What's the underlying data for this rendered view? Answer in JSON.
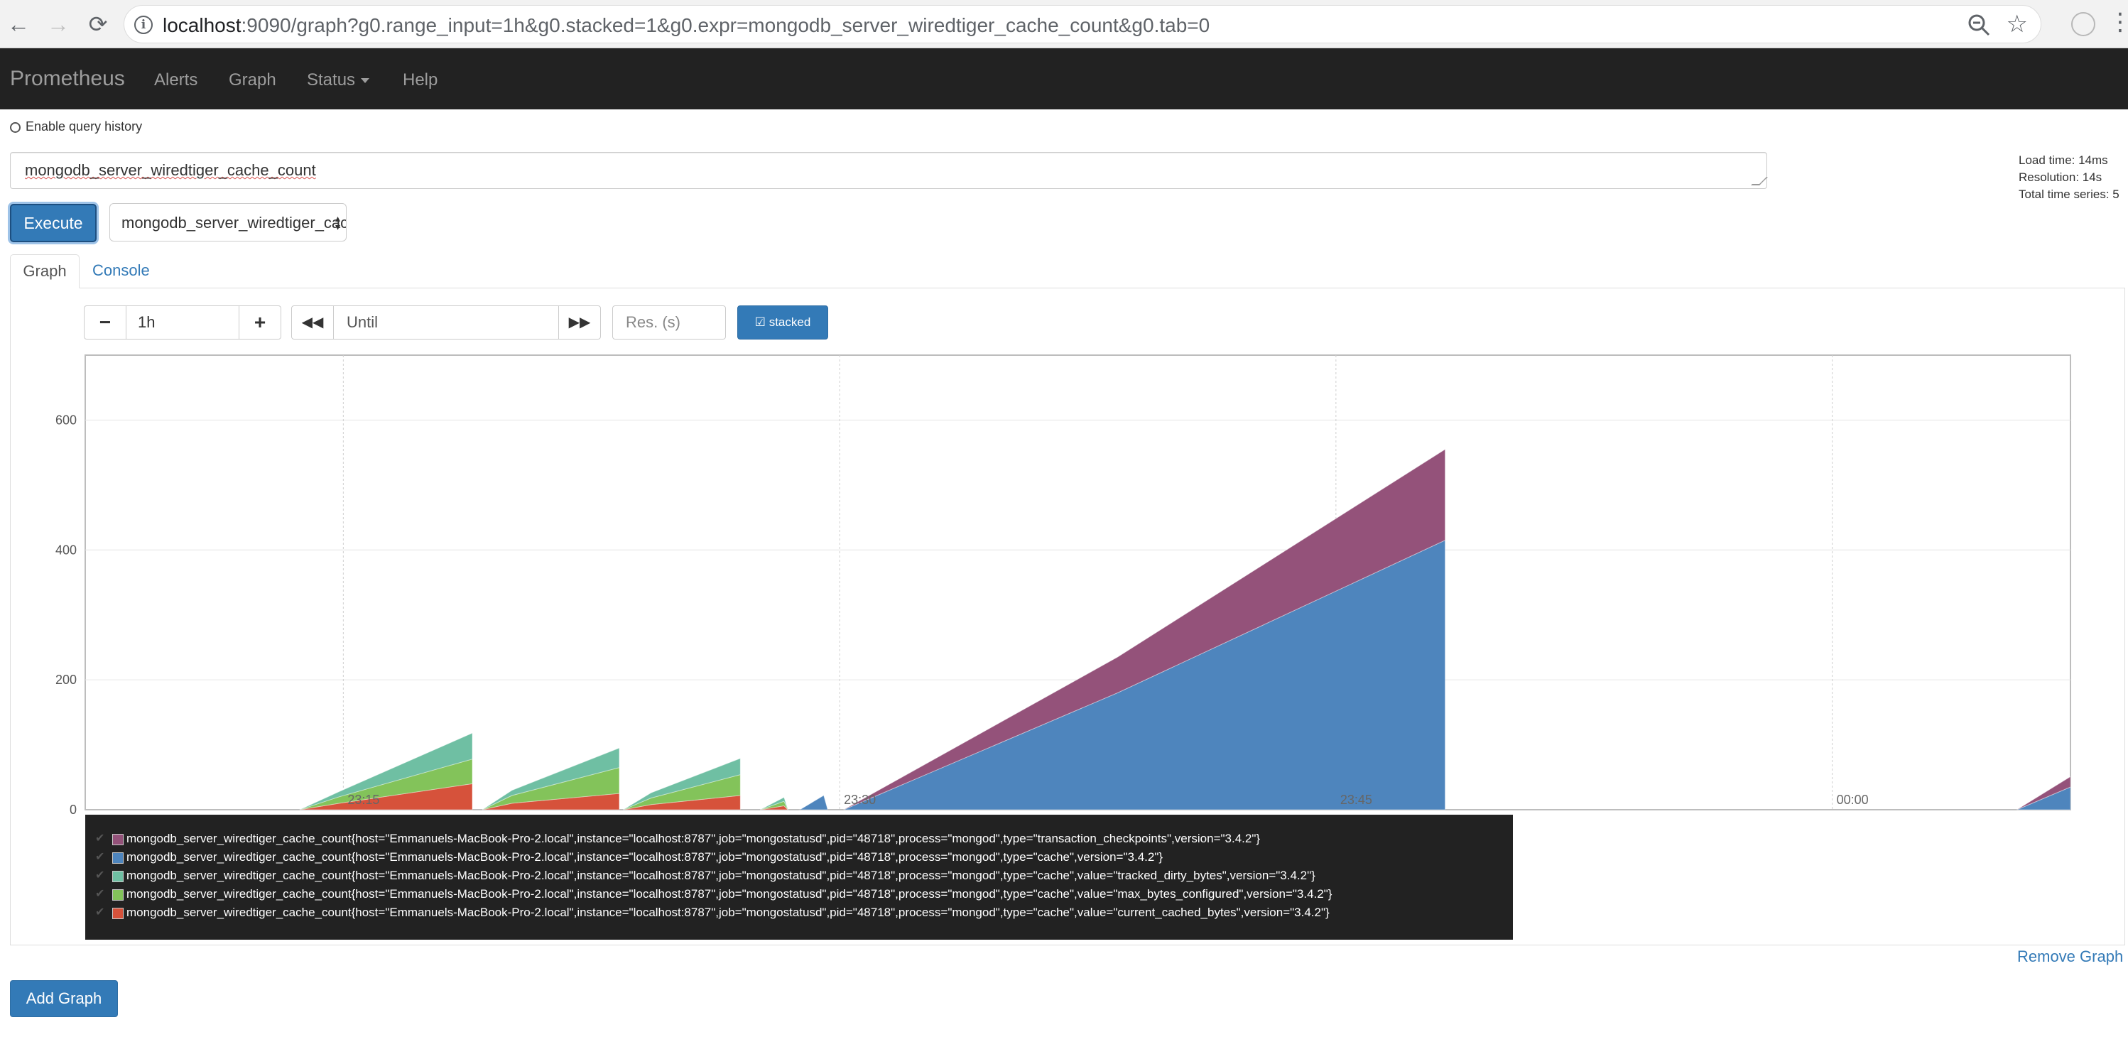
{
  "browser": {
    "url_host": "localhost",
    "url_rest": ":9090/graph?g0.range_input=1h&g0.stacked=1&g0.expr=mongodb_server_wiredtiger_cache_count&g0.tab=0"
  },
  "navbar": {
    "brand": "Prometheus",
    "items": [
      "Alerts",
      "Graph",
      "Status",
      "Help"
    ]
  },
  "query": {
    "history_label": "Enable query history",
    "expression": "mongodb_server_wiredtiger_cache_count",
    "execute_label": "Execute",
    "metric_select_value": "mongodb_server_wiredtiger_cache_count"
  },
  "stats": {
    "load_time": "Load time: 14ms",
    "resolution": "Resolution: 14s",
    "total_series": "Total time series: 5"
  },
  "tabs": [
    "Graph",
    "Console"
  ],
  "controls": {
    "minus": "−",
    "range_value": "1h",
    "plus": "+",
    "until_placeholder": "Until",
    "res_placeholder": "Res. (s)",
    "stacked_label": "stacked"
  },
  "chart_data": {
    "type": "area",
    "stacked": true,
    "y_ticks": [
      0,
      200,
      400,
      600
    ],
    "ylim": [
      0,
      700
    ],
    "x_tick_labels": [
      "23:15",
      "23:30",
      "23:45",
      "00:00"
    ],
    "series": [
      {
        "name": "mongodb_server_wiredtiger_cache_count{host=\"Emmanuels-MacBook-Pro-2.local\",instance=\"localhost:8787\",job=\"mongostatusd\",pid=\"48718\",process=\"mongod\",type=\"transaction_checkpoints\",version=\"3.4.2\"}",
        "color": "#94527a"
      },
      {
        "name": "mongodb_server_wiredtiger_cache_count{host=\"Emmanuels-MacBook-Pro-2.local\",instance=\"localhost:8787\",job=\"mongostatusd\",pid=\"48718\",process=\"mongod\",type=\"cache\",version=\"3.4.2\"}",
        "color": "#4e85bd"
      },
      {
        "name": "mongodb_server_wiredtiger_cache_count{host=\"Emmanuels-MacBook-Pro-2.local\",instance=\"localhost:8787\",job=\"mongostatusd\",pid=\"48718\",process=\"mongod\",type=\"cache\",value=\"tracked_dirty_bytes\",version=\"3.4.2\"}",
        "color": "#6fbfa3"
      },
      {
        "name": "mongodb_server_wiredtiger_cache_count{host=\"Emmanuels-MacBook-Pro-2.local\",instance=\"localhost:8787\",job=\"mongostatusd\",pid=\"48718\",process=\"mongod\",type=\"cache\",value=\"max_bytes_configured\",version=\"3.4.2\"}",
        "color": "#83c35a"
      },
      {
        "name": "mongodb_server_wiredtiger_cache_count{host=\"Emmanuels-MacBook-Pro-2.local\",instance=\"localhost:8787\",job=\"mongostatusd\",pid=\"48718\",process=\"mongod\",type=\"cache\",value=\"current_cached_bytes\",version=\"3.4.2\"}",
        "color": "#d6523b"
      }
    ],
    "segments": [
      {
        "t": [
          0.108,
          0.128,
          0.195
        ],
        "current_cached_bytes": [
          0,
          10,
          40
        ],
        "max_bytes_configured": [
          0,
          10,
          38
        ],
        "tracked_dirty_bytes": [
          0,
          8,
          40
        ]
      },
      {
        "t": [
          0.2,
          0.215,
          0.269
        ],
        "current_cached_bytes": [
          0,
          10,
          25
        ],
        "max_bytes_configured": [
          0,
          12,
          40
        ],
        "tracked_dirty_bytes": [
          0,
          8,
          30
        ]
      },
      {
        "t": [
          0.271,
          0.285,
          0.33
        ],
        "current_cached_bytes": [
          0,
          8,
          22
        ],
        "max_bytes_configured": [
          0,
          10,
          32
        ],
        "tracked_dirty_bytes": [
          0,
          8,
          25
        ]
      },
      {
        "t": [
          0.34,
          0.352,
          0.354
        ],
        "current_cached_bytes": [
          0,
          6,
          0
        ],
        "max_bytes_configured": [
          0,
          7,
          0
        ],
        "tracked_dirty_bytes": [
          0,
          6,
          0
        ]
      },
      {
        "t": [
          0.36,
          0.372,
          0.374
        ],
        "cache": [
          0,
          22,
          0
        ]
      },
      {
        "t": [
          0.382,
          0.52,
          0.685
        ],
        "cache": [
          0,
          180,
          415
        ],
        "transaction_checkpoints": [
          0,
          55,
          140
        ]
      },
      {
        "t": [
          0.973,
          1.0
        ],
        "cache": [
          0,
          35
        ],
        "transaction_checkpoints": [
          0,
          16
        ]
      }
    ]
  },
  "remove_graph_label": "Remove Graph",
  "add_graph_label": "Add Graph"
}
